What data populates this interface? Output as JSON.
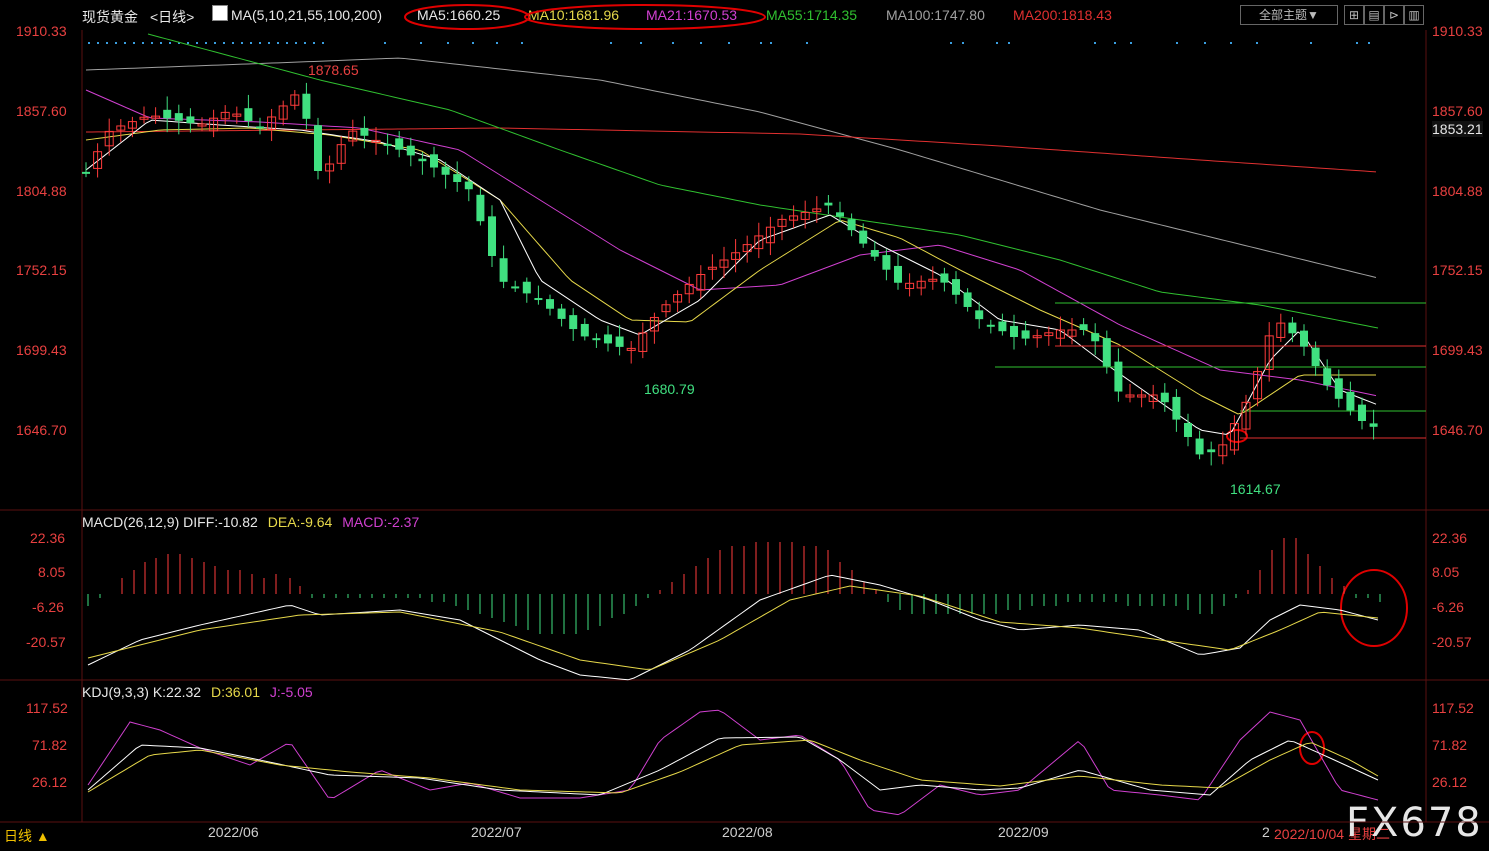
{
  "header": {
    "instrument": "现货黄金",
    "period_link": "<日线>",
    "ma_params": "MA(5,10,21,55,100,200)",
    "ma5": "MA5:1660.25",
    "ma10": "MA10:1681.96",
    "ma21": "MA21:1670.53",
    "ma55": "MA55:1714.35",
    "ma100": "MA100:1747.80",
    "ma200": "MA200:1818.43",
    "theme_button": "全部主题▼"
  },
  "price_axis": {
    "left": [
      "1910.33",
      "1857.60",
      "1804.88",
      "1752.15",
      "1699.43",
      "1646.70"
    ],
    "right": [
      "1910.33",
      "1857.60",
      "1804.88",
      "1752.15",
      "1699.43",
      "1646.70"
    ],
    "current_price_tag": "1853.21"
  },
  "annotations": {
    "high_label": "1878.65",
    "low1_label": "1680.79",
    "low2_label": "1614.67"
  },
  "macd": {
    "title": "MACD(26,12,9)",
    "diff": "DIFF:-10.82",
    "dea": "DEA:-9.64",
    "macd": "MACD:-2.37",
    "axis": [
      "22.36",
      "8.05",
      "-6.26",
      "-20.57"
    ]
  },
  "kdj": {
    "title": "KDJ(9,3,3)",
    "k": "K:22.32",
    "d": "D:36.01",
    "j": "J:-5.05",
    "axis": [
      "117.52",
      "71.82",
      "26.12"
    ]
  },
  "x_axis": [
    "2022/06",
    "2022/07",
    "2022/08",
    "2022/09",
    "2",
    "2022/10/04 星期二"
  ],
  "footer": {
    "period_tab": "日线 ▲"
  },
  "watermark": "FX678",
  "colors": {
    "up": "#ff3b3b",
    "down": "#40e080",
    "ma5": "#ffffff",
    "ma10": "#e6d84a",
    "ma21": "#d040d0",
    "ma55": "#30c030",
    "ma100": "#a0a0a0",
    "ma200": "#e03030",
    "axis_text": "#e84040",
    "circle": "#e00000"
  },
  "icons": [
    "chart-icon",
    "toolbar-grid-icon",
    "toolbar-list-icon",
    "toolbar-next-icon",
    "toolbar-table-icon"
  ]
}
